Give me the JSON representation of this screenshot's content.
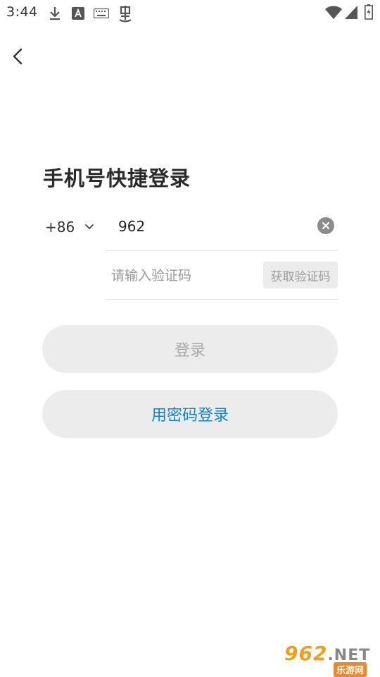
{
  "status_bar": {
    "time": "3:44",
    "left_icons": [
      "download-icon",
      "a-badge-icon",
      "keyboard-icon",
      "bug-icon"
    ],
    "right_icons": [
      "wifi-icon",
      "cellular-signal-icon",
      "battery-charging-icon"
    ]
  },
  "header": {
    "back_icon": "chevron-left-icon"
  },
  "login": {
    "title": "手机号快捷登录",
    "country_code": "+86",
    "phone_value": "962",
    "code_placeholder": "请输入验证码",
    "get_code_label": "获取验证码",
    "login_label": "登录",
    "password_login_label": "用密码登录"
  },
  "watermark": {
    "main": "962",
    "suffix": ".NET",
    "sub": "乐游网"
  },
  "colors": {
    "accent": "#1784c2",
    "button_bg": "#ececec",
    "disabled_text": "#a9a9a9"
  }
}
